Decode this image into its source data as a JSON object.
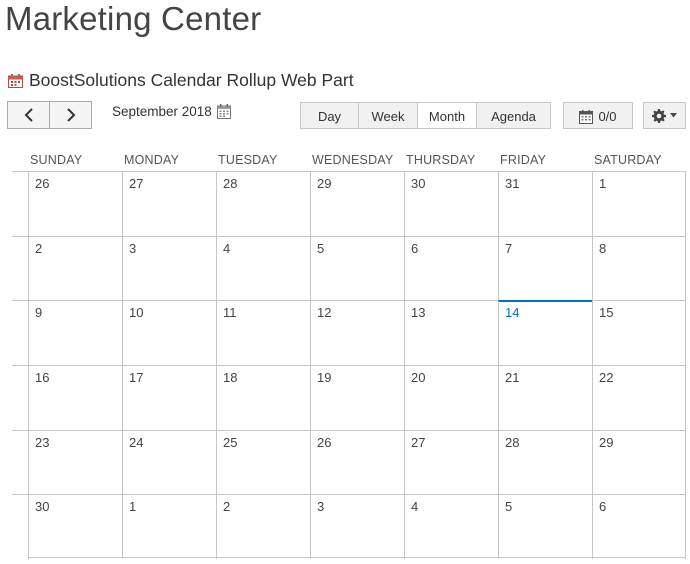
{
  "site": {
    "title": "Marketing Center"
  },
  "webpart": {
    "title": "BoostSolutions Calendar Rollup Web Part",
    "icon": "calendar-icon"
  },
  "toolbar": {
    "current_date": "September 2018",
    "views": [
      {
        "label": "Day",
        "active": false
      },
      {
        "label": "Week",
        "active": false
      },
      {
        "label": "Month",
        "active": true
      },
      {
        "label": "Agenda",
        "active": false
      }
    ],
    "event_count": "0/0"
  },
  "calendar": {
    "day_headers": [
      "SUNDAY",
      "MONDAY",
      "TUESDAY",
      "WEDNESDAY",
      "THURSDAY",
      "FRIDAY",
      "SATURDAY"
    ],
    "today": "14",
    "weeks": [
      [
        "26",
        "27",
        "28",
        "29",
        "30",
        "31",
        "1"
      ],
      [
        "2",
        "3",
        "4",
        "5",
        "6",
        "7",
        "8"
      ],
      [
        "9",
        "10",
        "11",
        "12",
        "13",
        "14",
        "15"
      ],
      [
        "16",
        "17",
        "18",
        "19",
        "20",
        "21",
        "22"
      ],
      [
        "23",
        "24",
        "25",
        "26",
        "27",
        "28",
        "29"
      ],
      [
        "30",
        "1",
        "2",
        "3",
        "4",
        "5",
        "6"
      ]
    ]
  },
  "colors": {
    "accent": "#0072c6",
    "grid_line": "#c6c6c6",
    "button_bg": "#f1f1f1"
  }
}
